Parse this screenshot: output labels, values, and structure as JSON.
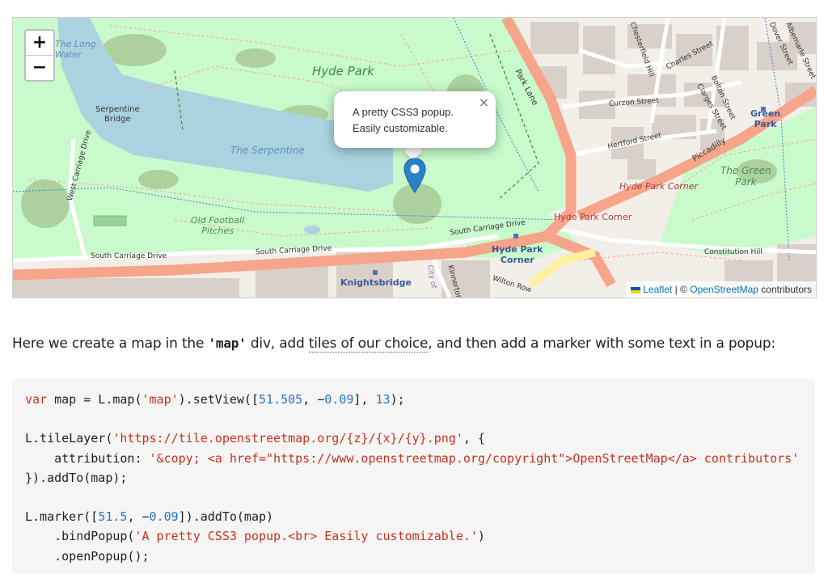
{
  "map": {
    "zoom_in_label": "+",
    "zoom_out_label": "−",
    "popup": {
      "line1": "A pretty CSS3 popup.",
      "line2": "Easily customizable.",
      "close_label": "×"
    },
    "labels": {
      "the_long_water": [
        "The Long",
        "Water"
      ],
      "hyde_park": "Hyde Park",
      "serpentine_bridge": [
        "Serpentine",
        "Bridge"
      ],
      "the_serpentine": "The Serpentine",
      "old_football_pitches": [
        "Old Football",
        "Pitches"
      ],
      "west_carriage_drive": "West Carriage Drive",
      "south_carriage_drive_1": "South Carriage Drive",
      "south_carriage_drive_2": "South Carriage Drive",
      "south_carriage_drive_3": "South Carriage Drive",
      "knightsbridge": "Knightsbridge",
      "hyde_park_corner_station": [
        "Hyde Park",
        "Corner"
      ],
      "hyde_park_corner_red": "Hyde Park Corner",
      "hyde_park_corner_italic": "Hyde Park Corner",
      "park_lane": "Park Lane",
      "piccadilly": "Piccadilly",
      "curzon_street": "Curzon Street",
      "hertford_street": "Hertford Street",
      "the_green_park": [
        "The Green",
        "Park"
      ],
      "green_park_station": [
        "Green",
        "Park"
      ],
      "constitution_hill": "Constitution Hill",
      "charles_street": "Charles Street",
      "bolton_street": "Bolton Street",
      "clarges_street": "Clarges Street",
      "chesterfield_hill": "Chesterfield Hill",
      "dover_street": "Dover Street",
      "albemarle_street": "Albemarle Street",
      "wilton_row": "Wilton Row",
      "kinnerton": "Kinnerton",
      "city_of": "City of"
    },
    "attribution": {
      "leaflet": "Leaflet",
      "separator": "| ©",
      "osm": "OpenStreetMap",
      "contributors": "contributors"
    }
  },
  "intro": {
    "part1": "Here we create a map in the ",
    "code": "'map'",
    "part2": " div, add ",
    "link": "tiles of our choice",
    "part3": ", and then add a marker with some text in a popup:"
  },
  "code": {
    "line1": {
      "kw": "var",
      "a": " map = L.map(",
      "s1": "'map'",
      "b": ").setView([",
      "n1": "51.505",
      "c": ", −",
      "n2": "0.09",
      "d": "], ",
      "n3": "13",
      "e": ");"
    },
    "line3": {
      "a": "L.tileLayer(",
      "s1": "'https://tile.openstreetmap.org/{z}/{x}/{y}.png'",
      "b": ", {"
    },
    "line4": {
      "a": "    attribution: ",
      "s1": "'&copy; <a href=\"https://www.openstreetmap.org/copyright\">OpenStreetMap</a> contributors'"
    },
    "line5": {
      "a": "}).addTo(map);"
    },
    "line7": {
      "a": "L.marker([",
      "n1": "51.5",
      "b": ", −",
      "n2": "0.09",
      "c": "]).addTo(map)"
    },
    "line8": {
      "a": "    .bindPopup(",
      "s1": "'A pretty CSS3 popup.<br> Easily customizable.'",
      "b": ")"
    },
    "line9": {
      "a": "    .openPopup();"
    }
  },
  "colors": {
    "water": "#aad3df",
    "park": "#c8facc",
    "major_road": "#f7a58a",
    "link": "#0078a8",
    "code_string": "#c8321e",
    "code_number": "#2a74c7",
    "marker": "#2a81cb"
  }
}
